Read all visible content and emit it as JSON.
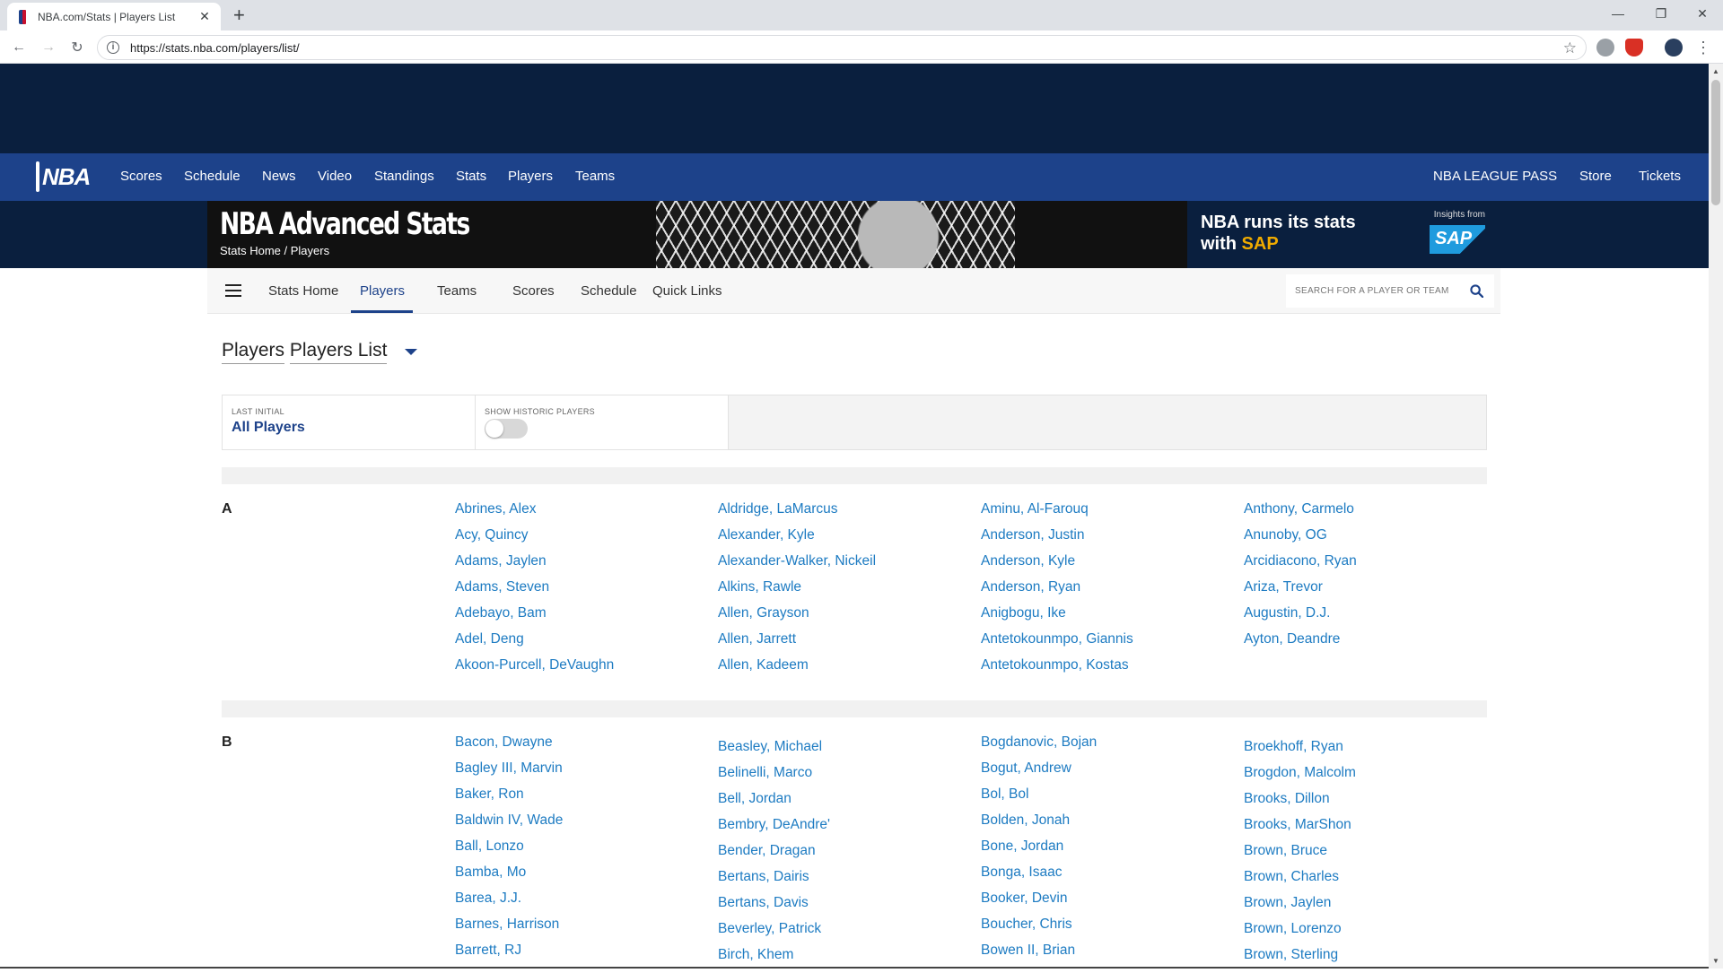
{
  "browser": {
    "tab_title": "NBA.com/Stats | Players List",
    "url": "https://stats.nba.com/players/list/"
  },
  "global_nav": {
    "logo_text": "NBA",
    "items": [
      "Scores",
      "Schedule",
      "News",
      "Video",
      "Standings",
      "Stats",
      "Players",
      "Teams"
    ],
    "right_items": [
      "NBA LEAGUE PASS",
      "Store",
      "Tickets"
    ]
  },
  "banner": {
    "title": "NBA Advanced Stats",
    "breadcrumb": "Stats Home / Players",
    "sap_line1": "NBA runs its stats",
    "sap_line2_prefix": "with ",
    "sap_line2_accent": "SAP",
    "sap_insights": "Insights from",
    "sap_logo": "SAP"
  },
  "subnav": {
    "items": [
      "Stats Home",
      "Players",
      "Teams",
      "Scores",
      "Schedule",
      "Quick Links"
    ],
    "active": "Players",
    "search_placeholder": "SEARCH FOR A PLAYER OR TEAM"
  },
  "heading": {
    "part1": "Players",
    "part2": "Players List"
  },
  "filters": {
    "last_initial_label": "LAST INITIAL",
    "last_initial_value": "All Players",
    "historic_label": "SHOW HISTORIC PLAYERS",
    "historic_on": false
  },
  "sections": [
    {
      "letter": "A",
      "columns": [
        [
          "Abrines, Alex",
          "Acy, Quincy",
          "Adams, Jaylen",
          "Adams, Steven",
          "Adebayo, Bam",
          "Adel, Deng",
          "Akoon-Purcell, DeVaughn"
        ],
        [
          "Aldridge, LaMarcus",
          "Alexander, Kyle",
          "Alexander-Walker, Nickeil",
          "Alkins, Rawle",
          "Allen, Grayson",
          "Allen, Jarrett",
          "Allen, Kadeem"
        ],
        [
          "Aminu, Al-Farouq",
          "Anderson, Justin",
          "Anderson, Kyle",
          "Anderson, Ryan",
          "Anigbogu, Ike",
          "Antetokounmpo, Giannis",
          "Antetokounmpo, Kostas"
        ],
        [
          "Anthony, Carmelo",
          "Anunoby, OG",
          "Arcidiacono, Ryan",
          "Ariza, Trevor",
          "Augustin, D.J.",
          "Ayton, Deandre"
        ]
      ]
    },
    {
      "letter": "B",
      "columns": [
        [
          "Bacon, Dwayne",
          "Bagley III, Marvin",
          "Baker, Ron",
          "Baldwin IV, Wade",
          "Ball, Lonzo",
          "Bamba, Mo",
          "Barea, J.J.",
          "Barnes, Harrison",
          "Barrett, RJ"
        ],
        [
          "Beasley, Michael",
          "Belinelli, Marco",
          "Bell, Jordan",
          "Bembry, DeAndre'",
          "Bender, Dragan",
          "Bertans, Dairis",
          "Bertans, Davis",
          "Beverley, Patrick",
          "Birch, Khem"
        ],
        [
          "Bogdanovic, Bojan",
          "Bogut, Andrew",
          "Bol, Bol",
          "Bolden, Jonah",
          "Bone, Jordan",
          "Bonga, Isaac",
          "Booker, Devin",
          "Boucher, Chris",
          "Bowen II, Brian"
        ],
        [
          "Broekhoff, Ryan",
          "Brogdon, Malcolm",
          "Brooks, Dillon",
          "Brooks, MarShon",
          "Brown, Bruce",
          "Brown, Charles",
          "Brown, Jaylen",
          "Brown, Lorenzo",
          "Brown, Sterling"
        ]
      ]
    }
  ]
}
